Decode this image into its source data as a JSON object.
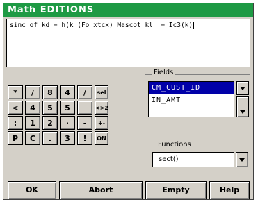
{
  "window": {
    "title": "Math EDITIONS"
  },
  "formula": {
    "text": "sinc of kd = h(k (Fo xtcx) Mascot kl  = Ic3(k)"
  },
  "keypad": {
    "rows": [
      [
        "*",
        "/",
        "8",
        "4",
        "/",
        "sel"
      ],
      [
        "<",
        "4",
        "5",
        "5",
        "",
        "<>2"
      ],
      [
        ":",
        "1",
        "2",
        "·",
        "-",
        "+-o2"
      ],
      [
        "P",
        "C",
        ".",
        "3",
        "!",
        "ON"
      ]
    ]
  },
  "fields": {
    "label": "Fields",
    "items": [
      "CM_CUST_ID",
      "IN_AMT"
    ],
    "selected_index": 0
  },
  "functions": {
    "label": "Functions",
    "value": "sect()"
  },
  "buttons": {
    "ok": "OK",
    "abort": "Abort",
    "empty": "Empty",
    "help": "Help"
  },
  "colors": {
    "title_bar": "#1e9a44",
    "selection": "#0000a8"
  }
}
